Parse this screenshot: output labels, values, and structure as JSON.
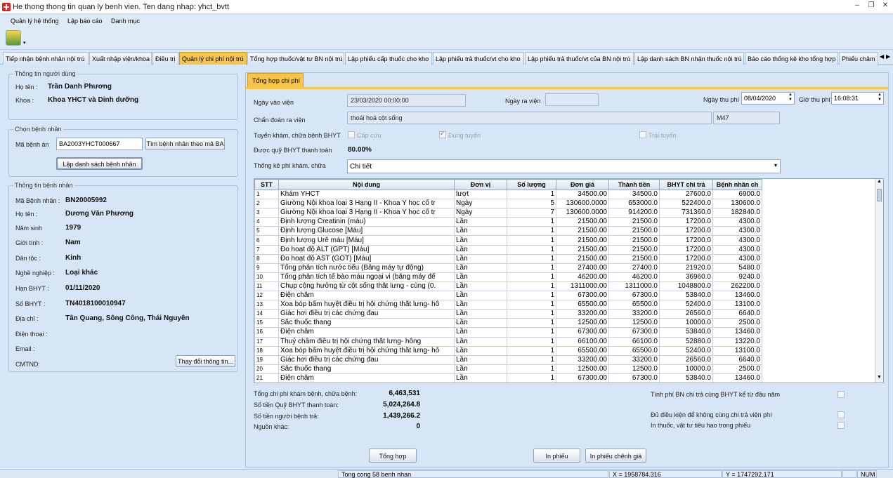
{
  "window": {
    "title": "He thong thong tin quan ly benh vien. Ten dang nhap: yhct_bvtt"
  },
  "menu": [
    "Quản lý hệ thống",
    "Lập báo cáo",
    "Danh mục"
  ],
  "tabs": [
    "Tiếp nhận bệnh nhân nội trú",
    "Xuất nhập viện/khoa",
    "Điều trị",
    "Quản lý chi phí nội trú",
    "Tổng hợp thuốc/vật tư BN nội trú",
    "Lập phiếu cấp thuốc cho kho",
    "Lập phiếu trả thuốc/vt cho kho",
    "Lập phiếu trả thuốc/vt của BN nội trú",
    "Lập danh sách BN nhận thuốc nội trú",
    "Báo cáo thống kê kho tổng hợp",
    "Phiếu châm"
  ],
  "user": {
    "group": "Thông tin người dùng",
    "name_label": "Họ tên :",
    "name": "Trần Danh Phương",
    "dept_label": "Khoa :",
    "dept": "Khoa YHCT và Dinh dưỡng"
  },
  "select_patient": {
    "group": "Chọn bệnh nhân",
    "record_label": "Mã bệnh án",
    "record_value": "BA2003YHCT000667",
    "search_btn": "Tìm bệnh nhân theo mã BA",
    "list_btn": "Lập danh sách bệnh nhân"
  },
  "patient": {
    "group": "Thông tin bệnh nhân",
    "fields": [
      {
        "label": "Mã Bệnh nhân :",
        "value": "BN20005992"
      },
      {
        "label": "Họ tên :",
        "value": "Dương Văn Phương"
      },
      {
        "label": "Năm sinh",
        "value": "1979"
      },
      {
        "label": "Giới tính :",
        "value": "Nam"
      },
      {
        "label": "Dân tộc :",
        "value": "Kinh"
      },
      {
        "label": "Nghề nghiệp :",
        "value": "Loại khác"
      },
      {
        "label": "Hạn BHYT :",
        "value": "01/11/2020"
      },
      {
        "label": "Số BHYT :",
        "value": "TN4018100010947"
      },
      {
        "label": "Địa chỉ :",
        "value": "Tân Quang, Sông Công, Thái Nguyên"
      },
      {
        "label": "Điện thoại :",
        "value": ""
      },
      {
        "label": "Email :",
        "value": ""
      },
      {
        "label": "CMTND:",
        "value": ""
      }
    ],
    "change_btn": "Thay đổi thông tin..."
  },
  "summary_tab": "Tổng hợp chi phí",
  "form": {
    "admit_label": "Ngày vào viện",
    "admit_value": "23/03/2020 00:00:00",
    "discharge_label": "Ngày ra viện",
    "discharge_value": "",
    "payday_label": "Ngày thu phí",
    "payday_value": "08/04/2020",
    "paytime_label": "Giờ thu phí",
    "paytime_value": "16:08:31",
    "diag_label": "Chẩn đoán ra viện",
    "diag_value": "thoái hoá cột sống",
    "diag_code": "M47",
    "route_label": "Tuyến khám, chữa bệnh BHYT",
    "emergency": "Cấp cứu",
    "correct_route": "Đúng tuyến",
    "wrong_route": "Trái tuyến",
    "fund_label": "Được quỹ BHYT thanh toán",
    "fund_value": "80.00%",
    "stat_label": "Thống kê phí khám, chữa",
    "stat_value": "Chi tiết"
  },
  "table": {
    "headers": [
      "STT",
      "Nội dung",
      "Đơn vị",
      "Số lượng",
      "Đơn giá",
      "Thành tiền",
      "BHYT chi trả",
      "Bệnh nhân ch"
    ],
    "rows": [
      [
        "1",
        "Khám YHCT",
        "lượt",
        "1",
        "34500.00",
        "34500.0",
        "27600.0",
        "6900.0"
      ],
      [
        "2",
        "Giường Nội khoa loại 3 Hạng II - Khoa Y học cổ tr",
        "Ngày",
        "5",
        "130600.0000",
        "653000.0",
        "522400.0",
        "130600.0"
      ],
      [
        "3",
        "Giường Nội khoa loại 3 Hạng II - Khoa Y học cổ tr",
        "Ngày",
        "7",
        "130600.0000",
        "914200.0",
        "731360.0",
        "182840.0"
      ],
      [
        "4",
        "Định lượng Creatinin (máu)",
        "Lần",
        "1",
        "21500.00",
        "21500.0",
        "17200.0",
        "4300.0"
      ],
      [
        "5",
        "Định lượng Glucose [Máu]",
        "Lần",
        "1",
        "21500.00",
        "21500.0",
        "17200.0",
        "4300.0"
      ],
      [
        "6",
        "Định lượng Urê máu [Máu]",
        "Lần",
        "1",
        "21500.00",
        "21500.0",
        "17200.0",
        "4300.0"
      ],
      [
        "7",
        "Đo hoạt độ ALT (GPT) [Máu]",
        "Lần",
        "1",
        "21500.00",
        "21500.0",
        "17200.0",
        "4300.0"
      ],
      [
        "8",
        "Đo hoạt độ AST (GOT) [Máu]",
        "Lần",
        "1",
        "21500.00",
        "21500.0",
        "17200.0",
        "4300.0"
      ],
      [
        "9",
        "Tổng phân tích nước tiểu (Bằng máy tự động)",
        "Lần",
        "1",
        "27400.00",
        "27400.0",
        "21920.0",
        "5480.0"
      ],
      [
        "10",
        "Tổng phân tích tế bào máu ngoại vi (bằng máy đế",
        "Lần",
        "1",
        "46200.00",
        "46200.0",
        "36960.0",
        "9240.0"
      ],
      [
        "11",
        "Chụp cộng hưởng từ cột sống thắt lưng - cùng (0.",
        "Lần",
        "1",
        "1311000.00",
        "1311000.0",
        "1048800.0",
        "262200.0"
      ],
      [
        "12",
        "Điện châm",
        "Lần",
        "1",
        "67300.00",
        "67300.0",
        "53840.0",
        "13460.0"
      ],
      [
        "13",
        "Xoa bóp bấm huyệt điều trị hội chứng thắt lưng- hô",
        "Lần",
        "1",
        "65500.00",
        "65500.0",
        "52400.0",
        "13100.0"
      ],
      [
        "14",
        "Giác hơi điều trị các chứng đau",
        "Lần",
        "1",
        "33200.00",
        "33200.0",
        "26560.0",
        "6640.0"
      ],
      [
        "15",
        "Sắc thuốc thang",
        "Lần",
        "1",
        "12500.00",
        "12500.0",
        "10000.0",
        "2500.0"
      ],
      [
        "16",
        "Điện châm",
        "Lần",
        "1",
        "67300.00",
        "67300.0",
        "53840.0",
        "13460.0"
      ],
      [
        "17",
        "Thuỷ châm điều trị hội chứng thắt lưng- hông",
        "Lần",
        "1",
        "66100.00",
        "66100.0",
        "52880.0",
        "13220.0"
      ],
      [
        "18",
        "Xoa bóp bấm huyệt điều trị hội chứng thắt lưng- hô",
        "Lần",
        "1",
        "65500.00",
        "65500.0",
        "52400.0",
        "13100.0"
      ],
      [
        "19",
        "Giác hơi điều trị các chứng đau",
        "Lần",
        "1",
        "33200.00",
        "33200.0",
        "26560.0",
        "6640.0"
      ],
      [
        "20",
        "Sắc thuốc thang",
        "Lần",
        "1",
        "12500.00",
        "12500.0",
        "10000.0",
        "2500.0"
      ],
      [
        "21",
        "Điện châm",
        "Lần",
        "1",
        "67300.00",
        "67300.0",
        "53840.0",
        "13460.0"
      ]
    ]
  },
  "totals": {
    "total_label": "Tổng chi phí khám bệnh, chữa bệnh:",
    "total_value": "6,463,531",
    "fund_label": "Số tiền Quỹ BHYT thanh toán:",
    "fund_value": "5,024,264.8",
    "patient_label": "Số tiền người bệnh trả:",
    "patient_value": "1,439,266.2",
    "other_label": "Nguồn khác:",
    "other_value": "0"
  },
  "options": [
    "Tính phí BN chi trả cùng BHYT kể từ đầu năm",
    "Đủ điều kiện để không cùng chi trả viện phí",
    "In thuốc, vật tư tiêu hao trong phiếu"
  ],
  "buttons": {
    "summary": "Tổng hợp",
    "print": "In phiếu",
    "print_diff": "In phiếu chênh giá"
  },
  "status": {
    "count": "Tong cong 58 benh nhan",
    "x": "X = 1958784.316",
    "y": "Y = 1747292.171",
    "num": "NUM"
  }
}
